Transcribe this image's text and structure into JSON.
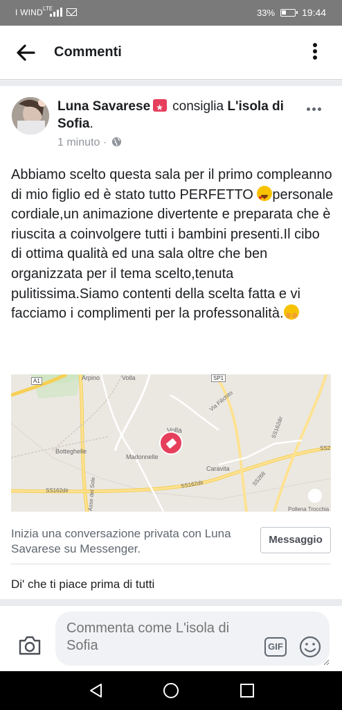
{
  "status_bar": {
    "carrier": "I WIND",
    "network": "LTE",
    "battery": "33%",
    "time": "19:44"
  },
  "header": {
    "title": "Commenti",
    "back_icon": "arrow-left-icon",
    "more_icon": "more-vertical-icon"
  },
  "post": {
    "author": "Luna Savarese",
    "action": "consiglia",
    "page_name": "L'isola di Sofia",
    "time": "1 minuto",
    "privacy_icon": "globe-icon",
    "body_part1": "Abbiamo scelto questa sala per il primo compleanno di mio figlio ed è stato tutto PERFETTO ",
    "body_part2": "personale cordiale,un animazione divertente e preparata che è riuscita a coinvolgere tutti i bambini presenti.Il cibo di ottima qualità ed una sala oltre che ben organizzata per il tema scelto,tenuta pulitissima.Siamo contenti della scelta fatta e vi facciamo i complimenti per la professonalità.",
    "emoji_1": "heart-eyes-emoji",
    "emoji_2": "hugging-face-emoji"
  },
  "map": {
    "labels": {
      "a1": "A1",
      "arpino": "Arpino",
      "volla_top": "Volla",
      "sp1": "SP1",
      "via_filichito": "Via Filichito",
      "volla": "Volla",
      "botteghelle": "Botteghelle",
      "madonnelle": "Madonnelle",
      "caravita": "Caravita",
      "ss162dir_a": "SS162dir",
      "ss162dir_b": "SS162dir",
      "ss162dir_c": "SS162dir",
      "ss268": "SS268",
      "ss2": "SS2",
      "asse_sole": "Asse del Sole",
      "pollena": "Pollena Trocchia"
    },
    "pin_color": "#e53f5c"
  },
  "messenger": {
    "text": "Inizia una conversazione privata con Luna Savarese su Messenger.",
    "button": "Messaggio"
  },
  "like_prompt": "Di' che ti piace prima di tutti",
  "composer": {
    "placeholder": "Commenta come L'isola di Sofia",
    "camera_icon": "camera-icon",
    "gif_label": "GIF",
    "emoji_icon": "smiley-icon"
  },
  "colors": {
    "accent": "#e53f5c",
    "text": "#1c1e21",
    "muted": "#606770"
  }
}
